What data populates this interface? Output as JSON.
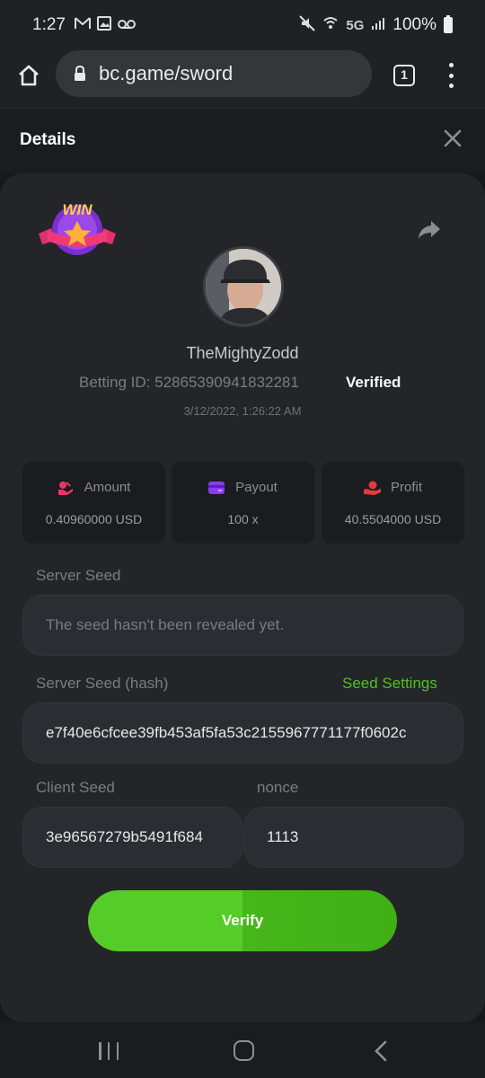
{
  "status_bar": {
    "time": "1:27",
    "network": "5G",
    "battery": "100%"
  },
  "browser": {
    "url": "bc.game/sword",
    "tab_count": "1"
  },
  "details": {
    "title": "Details"
  },
  "bet": {
    "badge": "WIN",
    "username": "TheMightyZodd",
    "betting_id_label": "Betting ID:",
    "betting_id": "52865390941832281",
    "verified": "Verified",
    "datetime": "3/12/2022, 1:26:22 AM"
  },
  "stats": {
    "amount": {
      "label": "Amount",
      "value": "0.40960000 USD",
      "icon": "coins-hand-icon",
      "color": "#e8356a"
    },
    "payout": {
      "label": "Payout",
      "value": "100 x",
      "icon": "card-icon",
      "color": "#8a3cf0"
    },
    "profit": {
      "label": "Profit",
      "value": "40.5504000 USD",
      "icon": "money-hand-icon",
      "color": "#e43a3a"
    }
  },
  "seeds": {
    "server_seed_label": "Server Seed",
    "server_seed_value": "The seed hasn't been revealed yet.",
    "server_seed_hash_label": "Server Seed (hash)",
    "seed_settings_link": "Seed Settings",
    "server_seed_hash_value": "e7f40e6cfcee39fb453af5fa53c2155967771177f0602c",
    "client_seed_label": "Client Seed",
    "client_seed_value": "3e96567279b5491f684",
    "nonce_label": "nonce",
    "nonce_value": "1113"
  },
  "actions": {
    "verify": "Verify"
  },
  "colors": {
    "accent_green": "#55cc27",
    "panel_bg": "#232529"
  }
}
